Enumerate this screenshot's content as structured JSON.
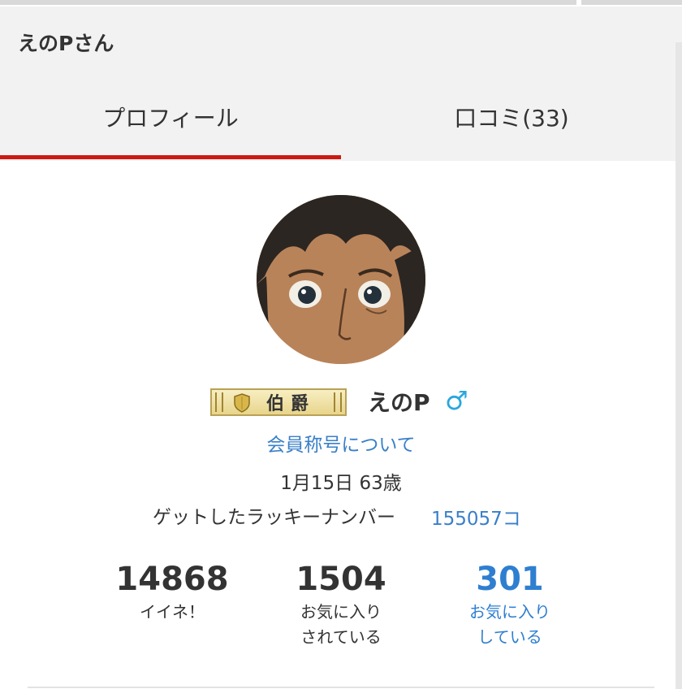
{
  "header": {
    "title": "えのPさん"
  },
  "tabs": [
    {
      "label": "プロフィール",
      "active": true
    },
    {
      "label": "口コミ(33)",
      "active": false
    }
  ],
  "profile": {
    "rank_badge": "伯爵",
    "name": "えのP",
    "gender_symbol": "♂",
    "rank_link": "会員称号について",
    "birthday_age": "1月15日 63歳",
    "lucky_label": "ゲットしたラッキーナンバー",
    "lucky_value": "155057コ"
  },
  "stats": [
    {
      "value": "14868",
      "label_line1": "イイネ！",
      "label_line2": ""
    },
    {
      "value": "1504",
      "label_line1": "お気に入り",
      "label_line2": "されている"
    },
    {
      "value": "301",
      "label_line1": "お気に入り",
      "label_line2": "している"
    }
  ],
  "colors": {
    "accent_red": "#cc1a12",
    "link_blue": "#3a7fc9",
    "gender_blue": "#2aa7dc"
  },
  "icons": {
    "gender": "male-symbol-icon",
    "rank": "shield-icon"
  }
}
